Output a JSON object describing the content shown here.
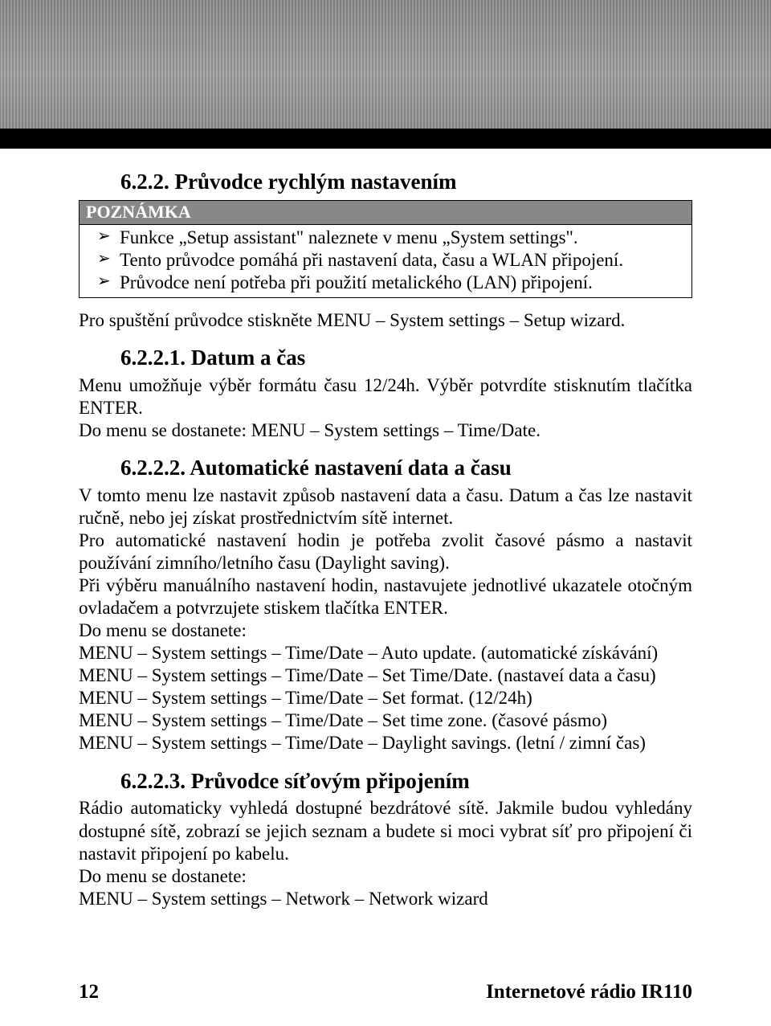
{
  "section622": {
    "number": "6.2.2.",
    "title": "Průvodce rychlým nastavením"
  },
  "note": {
    "label": "POZNÁMKA",
    "items": [
      "Funkce „Setup assistant\" naleznete v menu „System settings\".",
      "Tento průvodce pomáhá při nastavení data, času a WLAN připojení.",
      "Průvodce není potřeba při použití metalického (LAN) připojení."
    ]
  },
  "para_launch": "Pro spuštění průvodce stiskněte MENU – System settings – Setup wizard.",
  "section6221": {
    "number": "6.2.2.1.",
    "title": "Datum a čas",
    "p1": "Menu umožňuje výběr formátu času 12/24h. Výběr potvrdíte stisknutím tlačítka ENTER.",
    "p2": "Do menu se dostanete: MENU – System settings – Time/Date."
  },
  "section6222": {
    "number": "6.2.2.2.",
    "title": "Automatické nastavení data a času",
    "p1": "V tomto menu lze nastavit způsob nastavení data a času. Datum a čas lze nastavit ručně, nebo jej získat prostřednictvím sítě internet.",
    "p2": "Pro automatické nastavení hodin je potřeba zvolit časové pásmo a nastavit používání zimního/letního času (Daylight saving).",
    "p3": "Při výběru manuálního nastavení hodin, nastavujete jednotlivé ukazatele otočným ovladačem a potvrzujete stiskem tlačítka ENTER.",
    "p4": "Do menu se dostanete:",
    "menu1": "MENU – System settings – Time/Date – Auto update. (automatické získávání)",
    "menu2": "MENU – System settings – Time/Date – Set Time/Date. (nastaveí data a času)",
    "menu3": "MENU – System settings – Time/Date – Set format. (12/24h)",
    "menu4": "MENU – System settings – Time/Date – Set time zone. (časové pásmo)",
    "menu5": "MENU – System settings – Time/Date – Daylight savings. (letní / zimní čas)"
  },
  "section6223": {
    "number": "6.2.2.3.",
    "title": "Průvodce síťovým připojením",
    "p1": "Rádio automaticky vyhledá dostupné bezdrátové sítě. Jakmile budou vyhledány dostupné sítě, zobrazí se jejich seznam a budete si moci vybrat síť pro připojení či nastavit připojení po kabelu.",
    "p2": "Do menu se dostanete:",
    "menu1": "MENU – System settings – Network – Network wizard"
  },
  "footer": {
    "page": "12",
    "product": "Internetové rádio IR110"
  }
}
